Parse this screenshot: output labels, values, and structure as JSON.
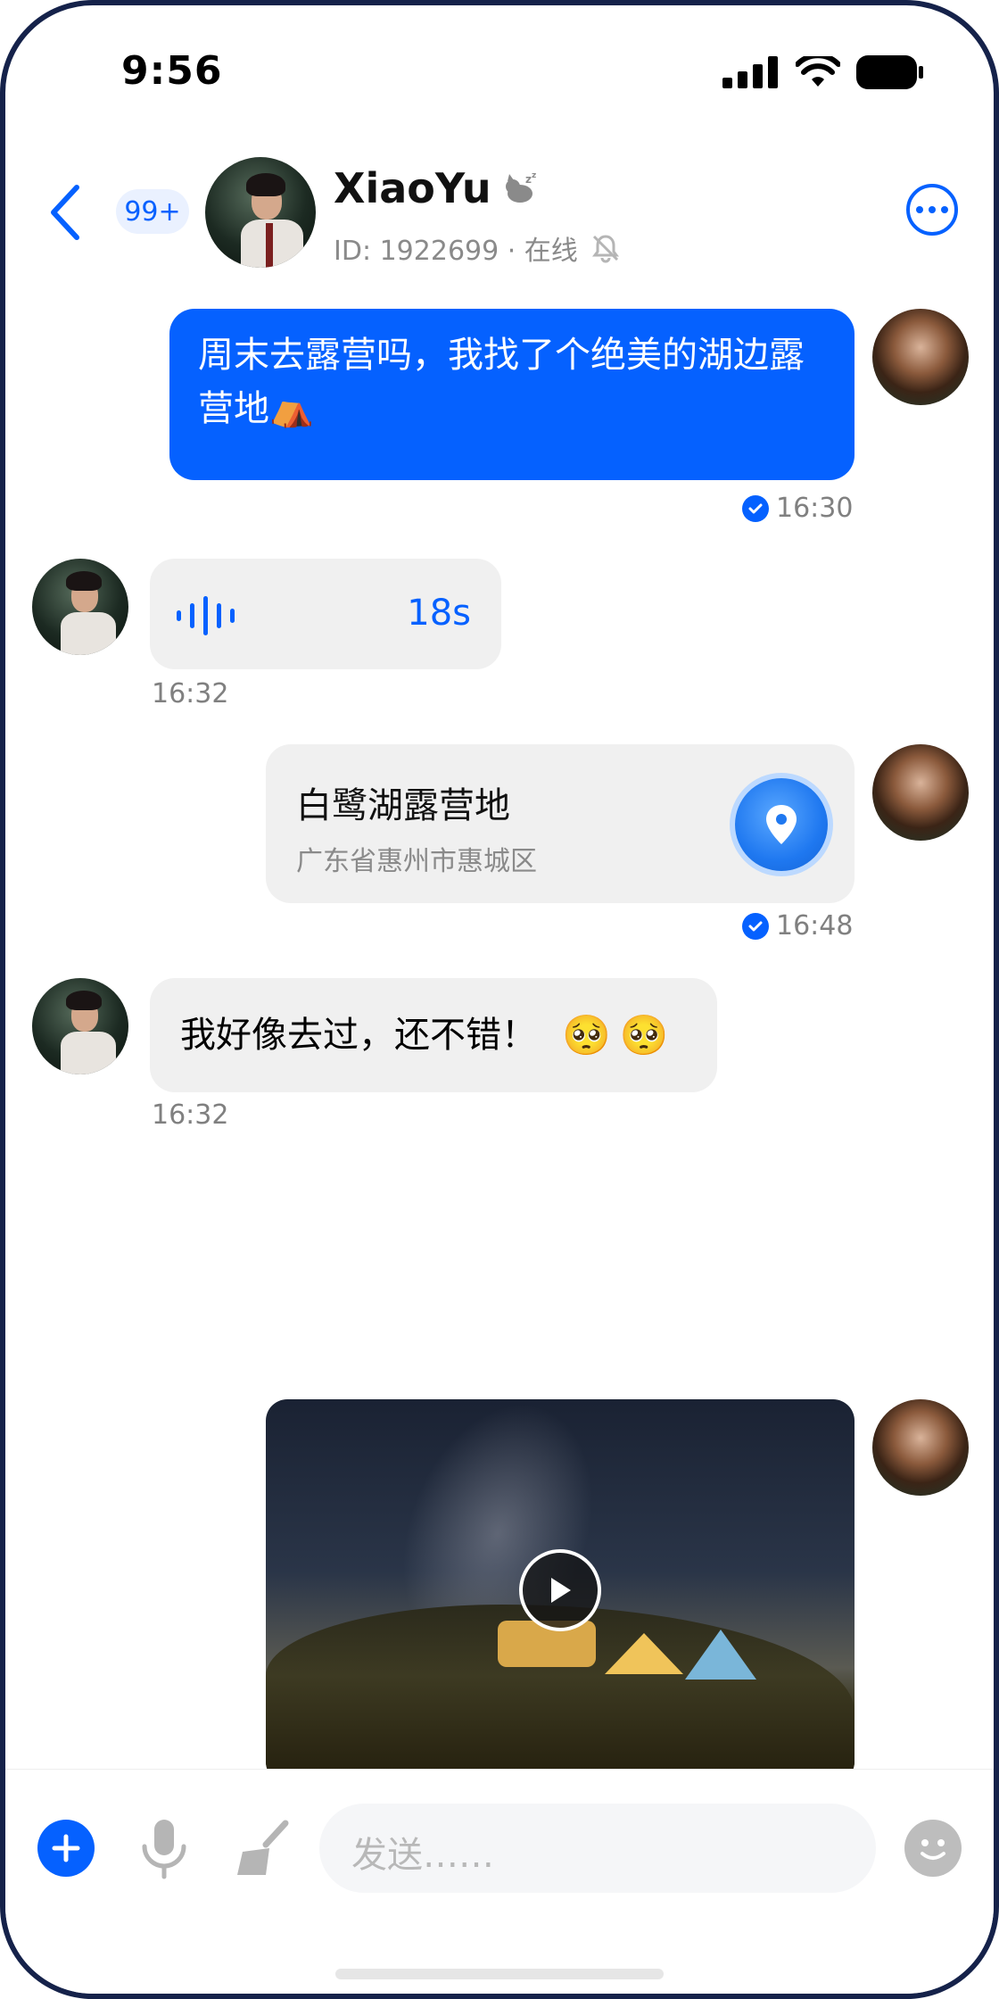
{
  "status_bar": {
    "time": "9:56"
  },
  "header": {
    "back_label": "",
    "unread_badge": "99+",
    "contact_name": "XiaoYu",
    "id_line": "ID: 1922699 · 在线"
  },
  "messages": {
    "m1": {
      "text": "周末去露营吗，我找了个绝美的湖边露营地⛺",
      "time": "16:30"
    },
    "m2": {
      "duration": "18s",
      "time": "16:32"
    },
    "m3": {
      "place": "白鹭湖露营地",
      "address": "广东省惠州市惠城区",
      "time": "16:48"
    },
    "m4": {
      "text": "我好像去过，还不错！",
      "emoji": "🥺🥺",
      "time": "16:32"
    }
  },
  "input": {
    "placeholder": "发送……"
  },
  "colors": {
    "accent": "#0561ff",
    "frame": "#15224a",
    "bubble_gray": "#f0f0f0"
  }
}
